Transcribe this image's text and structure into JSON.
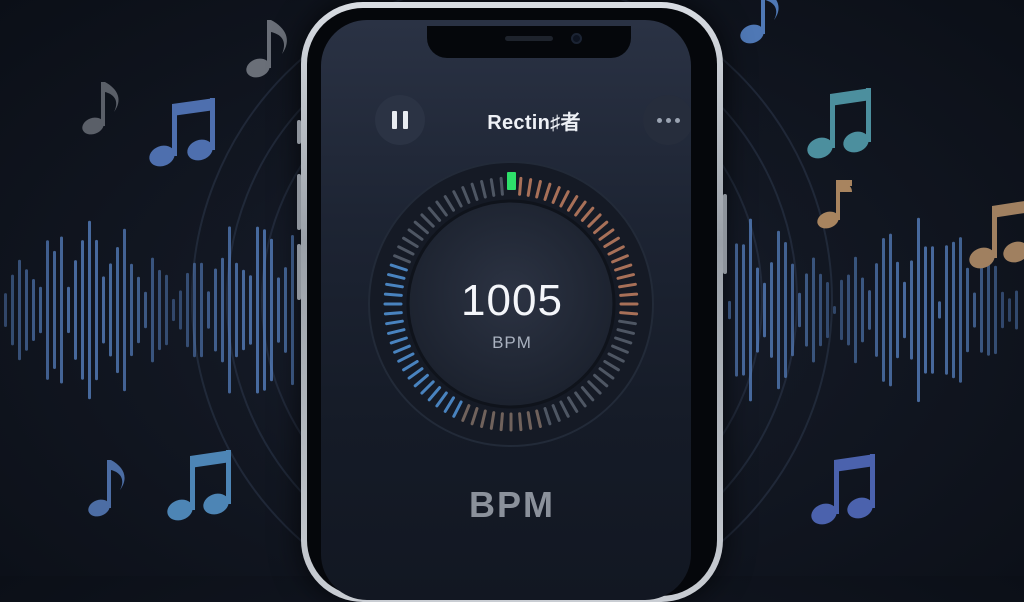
{
  "app": {
    "title": "Rectin♯者"
  },
  "tempo": {
    "value": "1005",
    "unit": "BPM"
  },
  "footer": {
    "label": "BPM"
  },
  "colors": {
    "accent_green": "#2ee06a",
    "warm_ticks": "#b97a5e",
    "cool_ticks": "#4f8fd0",
    "neutral_ticks": "#555d6a",
    "wave_blue": "#5a86c8"
  },
  "icons": {
    "pause": "pause-icon",
    "more": "more-dots-icon",
    "notes": "music-note-icon"
  }
}
